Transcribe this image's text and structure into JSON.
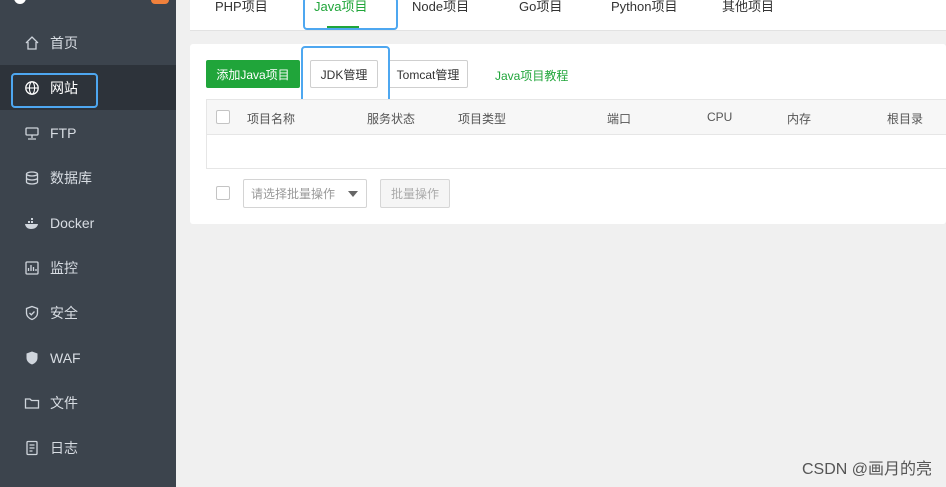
{
  "colors": {
    "accent": "#20a53a",
    "sidebar_bg": "#3c444d",
    "highlight": "#4ea7f0"
  },
  "sidebar": {
    "items": [
      {
        "label": "首页",
        "icon": "home-icon"
      },
      {
        "label": "网站",
        "icon": "globe-icon",
        "active": true
      },
      {
        "label": "FTP",
        "icon": "ftp-icon"
      },
      {
        "label": "数据库",
        "icon": "database-icon"
      },
      {
        "label": "Docker",
        "icon": "docker-icon"
      },
      {
        "label": "监控",
        "icon": "monitor-icon"
      },
      {
        "label": "安全",
        "icon": "shield-icon"
      },
      {
        "label": "WAF",
        "icon": "waf-shield-icon"
      },
      {
        "label": "文件",
        "icon": "folder-icon"
      },
      {
        "label": "日志",
        "icon": "log-icon"
      }
    ]
  },
  "tabs": [
    {
      "label": "PHP项目"
    },
    {
      "label": "Java项目",
      "active": true
    },
    {
      "label": "Node项目"
    },
    {
      "label": "Go项目"
    },
    {
      "label": "Python项目"
    },
    {
      "label": "其他项目"
    }
  ],
  "toolbar": {
    "add_label": "添加Java项目",
    "jdk_label": "JDK管理",
    "tomcat_label": "Tomcat管理",
    "tutorial_label": "Java项目教程"
  },
  "table": {
    "columns": [
      "项目名称",
      "服务状态",
      "项目类型",
      "端口",
      "CPU",
      "内存",
      "根目录"
    ]
  },
  "batch": {
    "select_placeholder": "请选择批量操作",
    "button_label": "批量操作"
  },
  "watermark": "CSDN @画月的亮"
}
